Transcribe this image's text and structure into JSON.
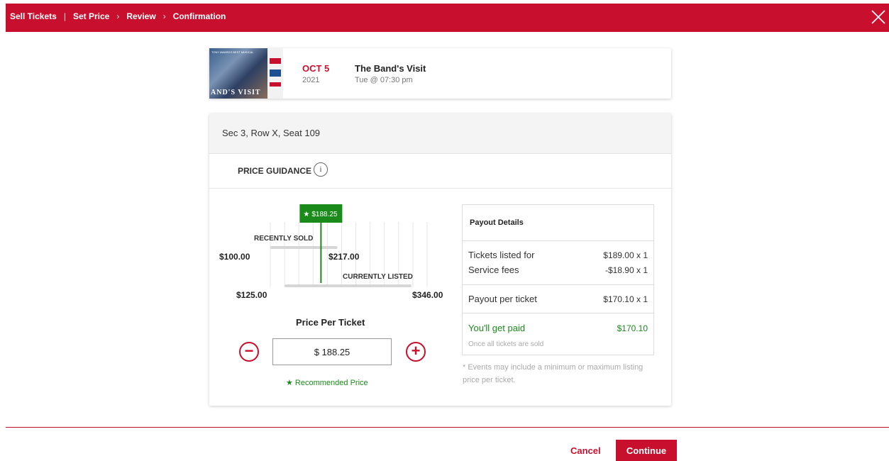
{
  "breadcrumbs": [
    "Sell Tickets",
    "Set Price",
    "Review",
    "Confirmation"
  ],
  "event": {
    "poster_text": "AND'S VISIT",
    "poster_top_text": "TONY AWARDS BEST MUSICAL",
    "month_day": "OCT 5",
    "year": "2021",
    "title": "The Band's Visit",
    "datetime": "Tue @ 07:30 pm"
  },
  "seat": "Sec 3, Row X, Seat 109",
  "price_guidance_label": "PRICE GUIDANCE",
  "info_glyph": "i",
  "price_guide": {
    "marker_label": "$188.25",
    "recently_sold_label": "RECENTLY SOLD",
    "currently_listed_label": "CURRENTLY LISTED",
    "recently_sold_min": "$100.00",
    "recently_sold_max": "$217.00",
    "currently_listed_min": "$125.00",
    "currently_listed_max": "$346.00",
    "recommended_value": 188.25,
    "scale_min": 100,
    "scale_max": 346
  },
  "price_per_ticket_label": "Price Per Ticket",
  "price_input_value": "$ 188.25",
  "recommended_label": "★ Recommended Price",
  "payout": {
    "title": "Payout Details",
    "tickets_listed_label": "Tickets listed for",
    "tickets_listed_value": "$189.00 x 1",
    "service_fees_label": "Service fees",
    "service_fees_value": "-$18.90 x 1",
    "payout_per_ticket_label": "Payout per ticket",
    "payout_per_ticket_value": "$170.10 x 1",
    "youll_get_paid_label": "You'll get paid",
    "youll_get_paid_value": "$170.10",
    "paid_note": "Once all tickets are sold"
  },
  "disclaimer": "* Events may include a minimum or maximum listing price per ticket.",
  "footer": {
    "cancel_label": "Cancel",
    "continue_label": "Continue"
  },
  "colors": {
    "brand": "#c8102e",
    "accent_green": "#1a8a1a"
  },
  "icons": [
    "close-icon",
    "info-icon",
    "minus-icon",
    "plus-icon",
    "star-icon",
    "chevron-right-icon"
  ]
}
